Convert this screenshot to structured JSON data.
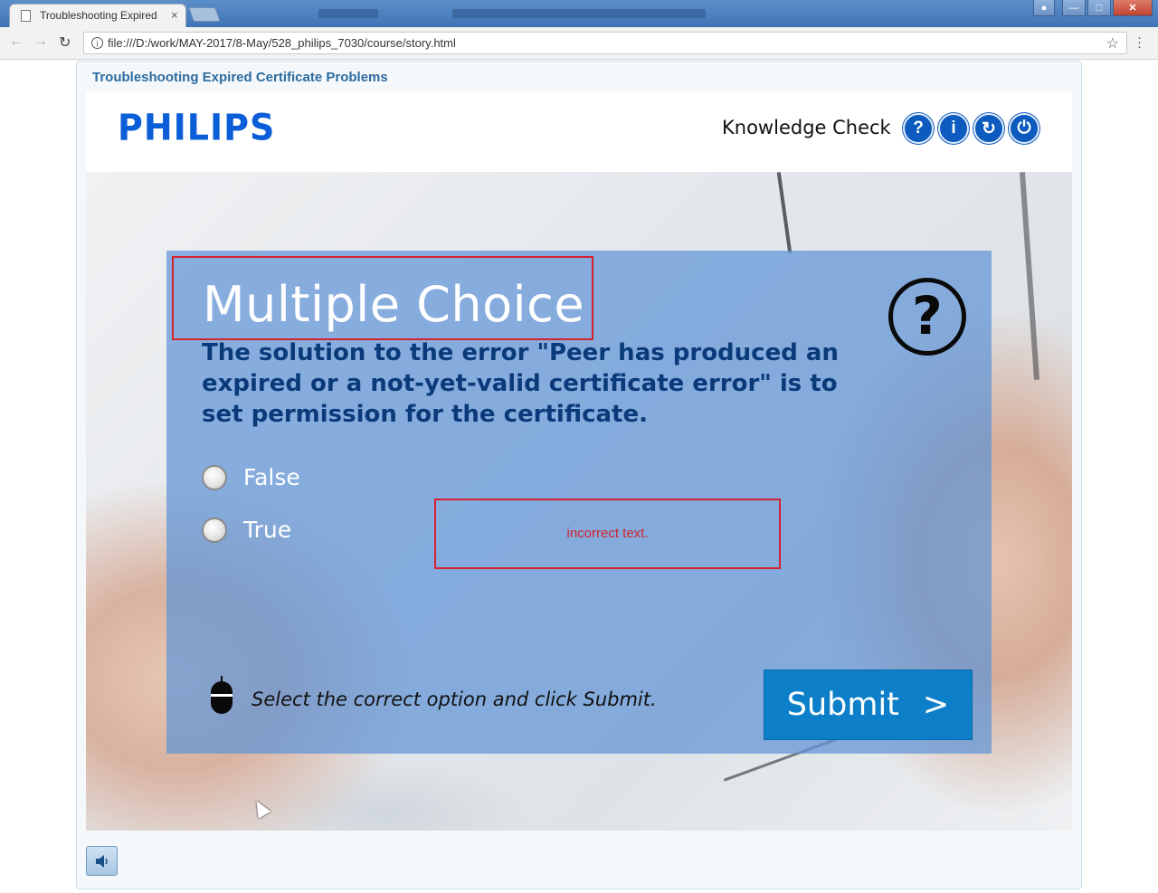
{
  "browser": {
    "tab_title": "Troubleshooting Expired",
    "tab_close": "×",
    "url": "file:///D:/work/MAY-2017/8-May/528_philips_7030/course/story.html",
    "back_glyph": "←",
    "forward_glyph": "→",
    "reload_glyph": "↻",
    "star_glyph": "☆",
    "info_glyph": "i",
    "min_glyph": "—",
    "max_glyph": "□",
    "close_glyph": "✕"
  },
  "course": {
    "title": "Troubleshooting  Expired Certificate Problems"
  },
  "header": {
    "logo": "PHILIPS",
    "section": "Knowledge Check",
    "buttons": [
      {
        "name": "help-icon",
        "glyph": "?"
      },
      {
        "name": "info-icon",
        "glyph": "i"
      },
      {
        "name": "replay-icon",
        "glyph": "↻"
      },
      {
        "name": "power-icon",
        "glyph": "⏻"
      }
    ]
  },
  "quiz": {
    "title": "Multiple Choice",
    "question": "The solution to the error \"Peer has produced an expired or a not-yet-valid certificate error\" is to set permission for the certificate.",
    "help_glyph": "?",
    "options": [
      {
        "label": "False",
        "selected": false
      },
      {
        "label": "True",
        "selected": false
      }
    ],
    "feedback": "incorrect text.",
    "instruction": "Select the correct option and click Submit.",
    "submit_label": "Submit",
    "submit_arrow": ">"
  },
  "colors": {
    "brand_blue": "#0b5ed7",
    "panel_blue": "#6094d7",
    "submit_blue": "#0d7fc9",
    "error_red": "#d4222e",
    "question_navy": "#0a3a7a"
  }
}
